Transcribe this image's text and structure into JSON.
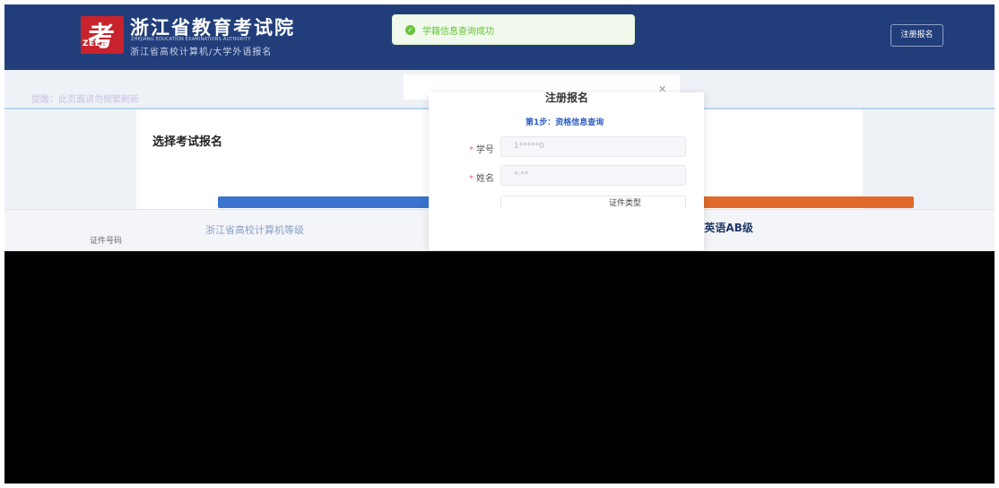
{
  "header": {
    "logo_glyph": "考",
    "logo_abbr": "ZEEA",
    "org_cn": "浙江省教育考试院",
    "org_en": "ZHEJIANG EDUCATION EXAMINATIONS AUTHORITY",
    "org_sub": "浙江省高校计算机/大学外语报名",
    "register_label": "注册报名"
  },
  "toast": {
    "message": "学籍信息查询成功",
    "icon": "check-circle-icon",
    "color": "#67c23a"
  },
  "page": {
    "notice": "提醒：此页面请勿频繁刷新",
    "section_title": "选择考试报名",
    "exam_label": "证件号码",
    "exam_name": "浙江省大学外语三级/英语AB级",
    "exam_link": "浙江省高校计算机等级"
  },
  "modal": {
    "title": "注册报名",
    "close_icon": "close-icon",
    "step": "第1步：资格信息查询",
    "fields": [
      {
        "label": "学号",
        "value": "1*****0"
      },
      {
        "label": "姓名",
        "value": "*·**"
      }
    ],
    "id_type_label": "证件类型"
  },
  "colors": {
    "header_bg": "#223e7a",
    "brand_red": "#c8232c",
    "accent_blue": "#2d5fc4",
    "success": "#67c23a"
  }
}
